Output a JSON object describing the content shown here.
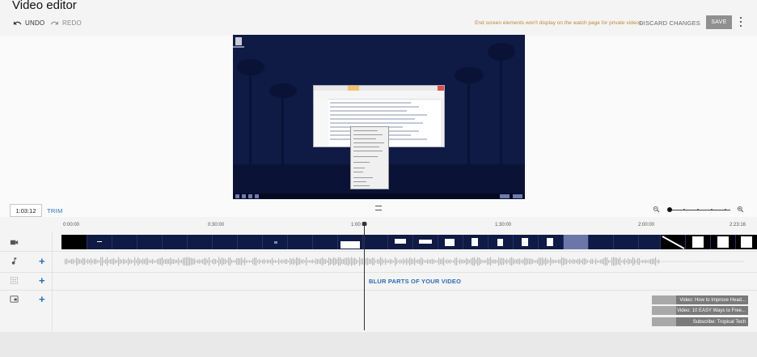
{
  "header": {
    "title": "Video editor",
    "undo_label": "UNDO",
    "redo_label": "REDO",
    "notice": "End screen elements won't display on the watch page for private videos.",
    "discard_label": "DISCARD CHANGES",
    "save_label": "SAVE"
  },
  "timeline": {
    "timecode": "1:03:12",
    "trim_label": "TRIM",
    "ruler_ticks": [
      "0:00:00",
      "0:30:00",
      "1:00:00",
      "1:30:00",
      "2:00:00",
      "2:23:16"
    ],
    "blur_label": "BLUR PARTS OF YOUR VIDEO",
    "end_screen_elements": [
      "Video: How to Improve Head...",
      "Video: 10 EASY Ways to Free...",
      "Subscribe: Tropical Tech"
    ]
  },
  "icons": {
    "undo": "undo-icon",
    "redo": "redo-icon",
    "more": "more-vert-icon",
    "zoom_out": "zoom-out-icon",
    "zoom_in": "zoom-in-icon",
    "video_track": "video-camera-icon",
    "audio_track": "music-note-icon",
    "blur_track": "blur-icon",
    "endscreen_track": "end-screen-icon"
  },
  "colors": {
    "accent": "#2a6db5",
    "notice": "#c0863a",
    "save_button": "#909090",
    "preview_bg": "#0f1a45"
  }
}
